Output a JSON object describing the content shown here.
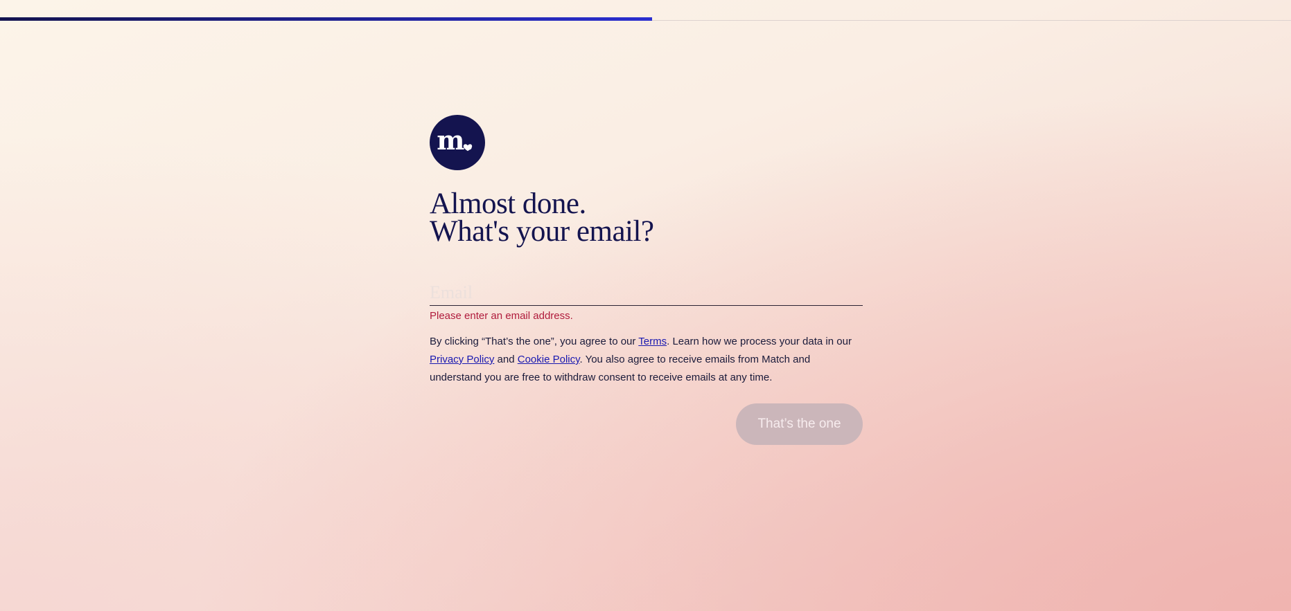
{
  "progress": {
    "percent": 60
  },
  "logo": {
    "letter": "m.",
    "icon": "heart-icon",
    "color": "#14144f"
  },
  "headline": {
    "line1": "Almost done.",
    "line2": "What's your email?"
  },
  "email": {
    "placeholder": "Email",
    "value": "",
    "error": "Please enter an email address."
  },
  "consent": {
    "text1": "By clicking “That’s the one”, you agree to our ",
    "terms_link": "Terms",
    "text2": ". Learn how we process your data in our ",
    "privacy_link": "Privacy Policy",
    "text3": " and ",
    "cookie_link": "Cookie Policy",
    "text4": ". You also agree to receive emails from Match and understand you are free to withdraw consent to receive emails at any time."
  },
  "submit": {
    "label": "That’s the one",
    "disabled": true
  },
  "colors": {
    "primary": "#14144f",
    "accent": "#2a2ed0",
    "error": "#b01b3c",
    "link": "#1818b0",
    "button_disabled": "#cbb6ba"
  }
}
